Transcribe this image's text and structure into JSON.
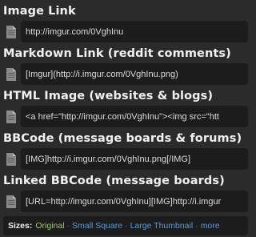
{
  "sections": [
    {
      "title": "Image Link",
      "value": "http://imgur.com/0VghInu"
    },
    {
      "title": "Markdown Link (reddit comments)",
      "value": "[Imgur](http://i.imgur.com/0VghInu.png)"
    },
    {
      "title": "HTML Image (websites & blogs)",
      "value": "<a href=\"http://imgur.com/0VghInu\"><img src=\"htt"
    },
    {
      "title": "BBCode (message boards & forums)",
      "value": "[IMG]http://i.imgur.com/0VghInu.png[/IMG]"
    },
    {
      "title": "Linked BBCode (message boards)",
      "value": "[URL=http://imgur.com/0VghInu][IMG]http://i.imgur"
    }
  ],
  "sizes": {
    "label": "Sizes:",
    "original": "Original",
    "small_square": "Small Square",
    "large_thumbnail": "Large Thumbnail",
    "more": "more",
    "separator": "·"
  },
  "icons": {
    "copy": "copy-icon"
  },
  "colors": {
    "background": "#2b2b2b",
    "field": "#1c1c1c",
    "original": "#8fd14f",
    "link": "#5b9bd5"
  }
}
